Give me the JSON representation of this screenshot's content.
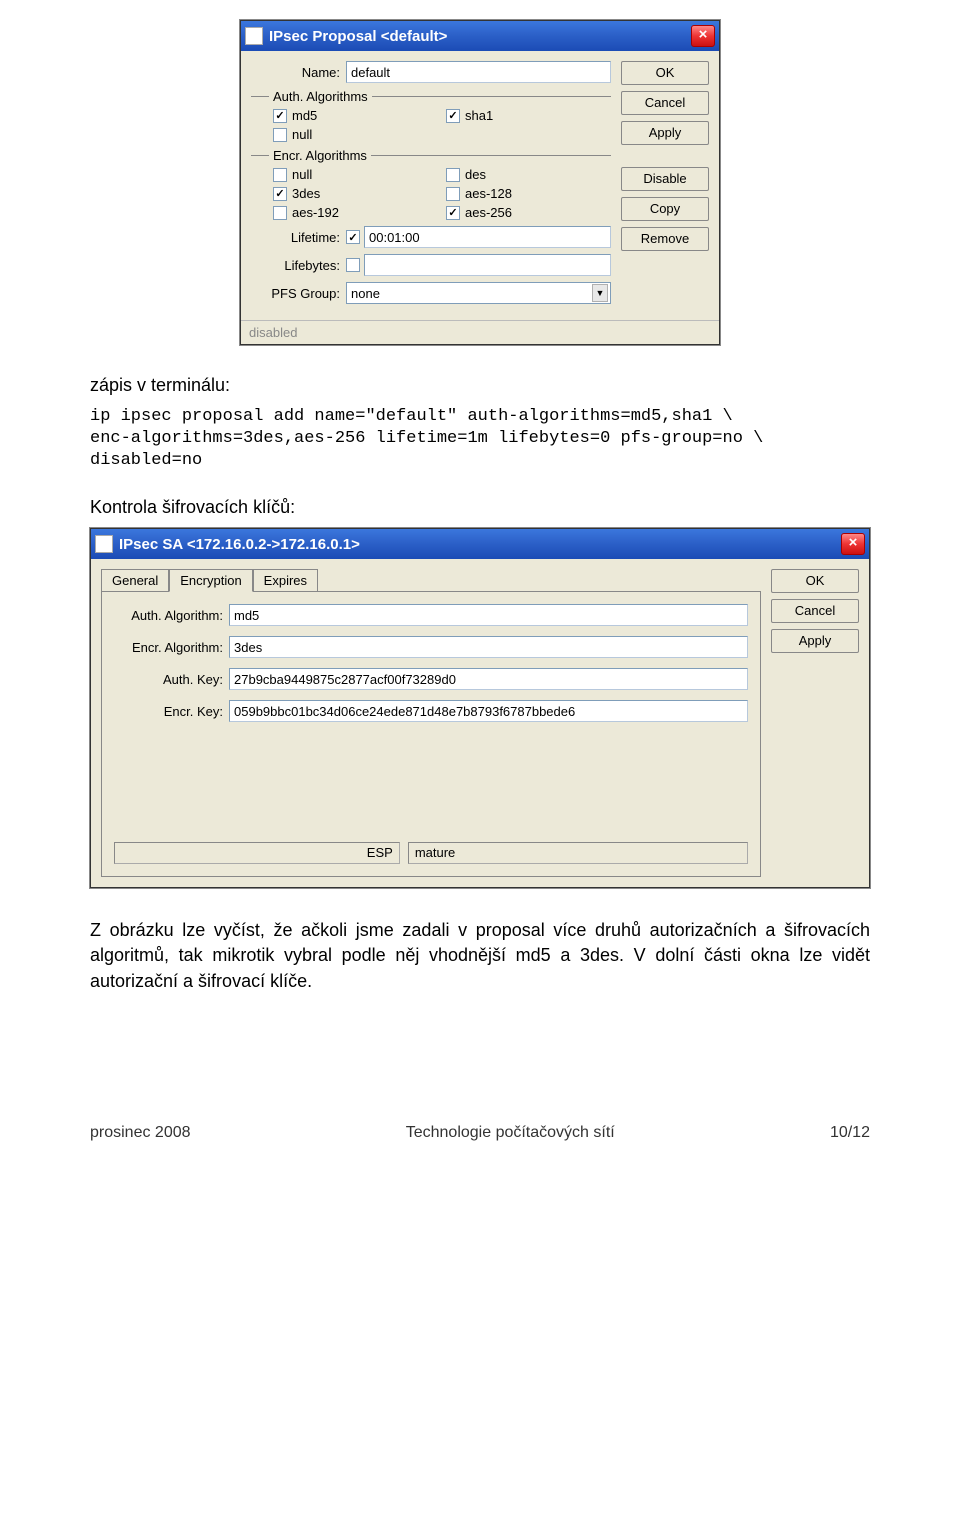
{
  "dialog1": {
    "title": "IPsec Proposal <default>",
    "name_label": "Name:",
    "name_value": "default",
    "auth_group": "Auth. Algorithms",
    "auth": {
      "md5": {
        "label": "md5",
        "checked": true
      },
      "sha1": {
        "label": "sha1",
        "checked": true
      },
      "null": {
        "label": "null",
        "checked": false
      }
    },
    "encr_group": "Encr. Algorithms",
    "encr": {
      "null": {
        "label": "null",
        "checked": false
      },
      "des": {
        "label": "des",
        "checked": false
      },
      "3des": {
        "label": "3des",
        "checked": true
      },
      "aes128": {
        "label": "aes-128",
        "checked": false
      },
      "aes192": {
        "label": "aes-192",
        "checked": false
      },
      "aes256": {
        "label": "aes-256",
        "checked": true
      }
    },
    "lifetime_label": "Lifetime:",
    "lifetime_checked": true,
    "lifetime_value": "00:01:00",
    "lifebytes_label": "Lifebytes:",
    "lifebytes_checked": false,
    "lifebytes_value": "",
    "pfs_label": "PFS Group:",
    "pfs_value": "none",
    "buttons": {
      "ok": "OK",
      "cancel": "Cancel",
      "apply": "Apply",
      "disable": "Disable",
      "copy": "Copy",
      "remove": "Remove"
    },
    "status": "disabled"
  },
  "text": {
    "heading1": "zápis v terminálu:",
    "code": "ip ipsec proposal add name=\"default\" auth-algorithms=md5,sha1 \\\nenc-algorithms=3des,aes-256 lifetime=1m lifebytes=0 pfs-group=no \\\ndisabled=no",
    "heading2": "Kontrola šifrovacích klíčů:",
    "body": "Z obrázku lze vyčíst, že ačkoli jsme zadali v proposal více druhů autorizačních a šifrovacích algoritmů, tak mikrotik vybral podle něj vhodnější md5 a 3des. V dolní části okna lze vidět autorizační a šifrovací klíče."
  },
  "dialog2": {
    "title": "IPsec SA <172.16.0.2->172.16.0.1>",
    "tabs": {
      "general": "General",
      "encryption": "Encryption",
      "expires": "Expires"
    },
    "auth_alg_label": "Auth. Algorithm:",
    "auth_alg_value": "md5",
    "encr_alg_label": "Encr. Algorithm:",
    "encr_alg_value": "3des",
    "auth_key_label": "Auth. Key:",
    "auth_key_value": "27b9cba9449875c2877acf00f73289d0",
    "encr_key_label": "Encr. Key:",
    "encr_key_value": "059b9bbc01bc34d06ce24ede871d48e7b8793f6787bbede6",
    "status_left": "ESP",
    "status_right": "mature",
    "buttons": {
      "ok": "OK",
      "cancel": "Cancel",
      "apply": "Apply"
    }
  },
  "footer": {
    "left": "prosinec  2008",
    "center": "Technologie počítačových sítí",
    "right": "10/12"
  }
}
